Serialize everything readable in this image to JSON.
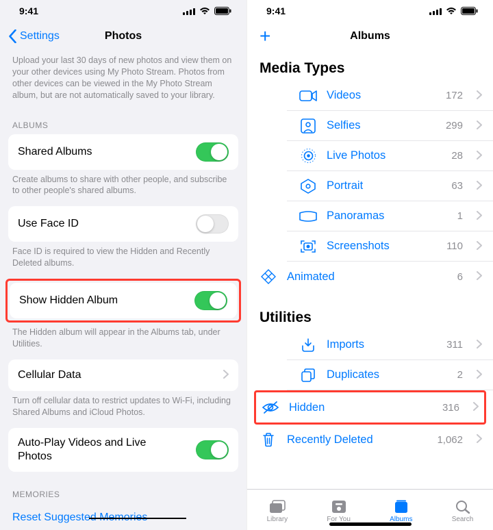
{
  "status": {
    "time": "9:41"
  },
  "left": {
    "back_label": "Settings",
    "title": "Photos",
    "stream_desc": "Upload your last 30 days of new photos and view them on your other devices using My Photo Stream. Photos from other devices can be viewed in the My Photo Stream album, but are not automatically saved to your library.",
    "section_albums": "ALBUMS",
    "shared_albums": "Shared Albums",
    "shared_desc": "Create albums to share with other people, and subscribe to other people's shared albums.",
    "use_faceid": "Use Face ID",
    "faceid_desc": "Face ID is required to view the Hidden and Recently Deleted albums.",
    "show_hidden": "Show Hidden Album",
    "hidden_desc": "The Hidden album will appear in the Albums tab, under Utilities.",
    "cellular": "Cellular Data",
    "cellular_desc": "Turn off cellular data to restrict updates to Wi-Fi, including Shared Albums and iCloud Photos.",
    "autoplay": "Auto-Play Videos and Live Photos",
    "section_memories": "MEMORIES",
    "reset_link": "Reset Suggested Memories"
  },
  "right": {
    "title": "Albums",
    "media_types": "Media Types",
    "utilities": "Utilities",
    "rows_media": [
      {
        "label": "Videos",
        "count": "172",
        "icon": "video"
      },
      {
        "label": "Selfies",
        "count": "299",
        "icon": "selfie"
      },
      {
        "label": "Live Photos",
        "count": "28",
        "icon": "live"
      },
      {
        "label": "Portrait",
        "count": "63",
        "icon": "portrait"
      },
      {
        "label": "Panoramas",
        "count": "1",
        "icon": "pano"
      },
      {
        "label": "Screenshots",
        "count": "110",
        "icon": "screenshot"
      },
      {
        "label": "Animated",
        "count": "6",
        "icon": "animated"
      }
    ],
    "rows_util": [
      {
        "label": "Imports",
        "count": "311",
        "icon": "imports"
      },
      {
        "label": "Duplicates",
        "count": "2",
        "icon": "dup"
      },
      {
        "label": "Hidden",
        "count": "316",
        "icon": "hidden"
      },
      {
        "label": "Recently Deleted",
        "count": "1,062",
        "icon": "trash"
      }
    ],
    "tabs": [
      {
        "label": "Library"
      },
      {
        "label": "For You"
      },
      {
        "label": "Albums"
      },
      {
        "label": "Search"
      }
    ]
  }
}
